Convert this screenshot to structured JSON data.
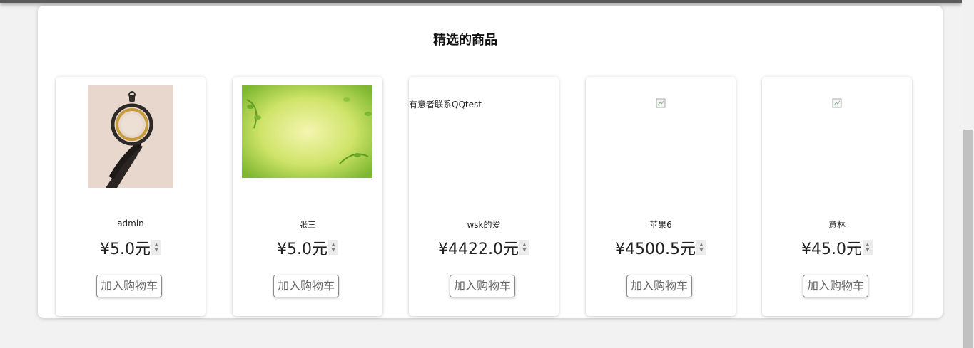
{
  "section": {
    "title": "精选的商品"
  },
  "products": [
    {
      "name": "admin",
      "price": "¥5.0元",
      "button": "加入购物车",
      "image": "pocket-watch-photo"
    },
    {
      "name": "张三",
      "price": "¥5.0元",
      "button": "加入购物车",
      "image": "green-leaves-photo"
    },
    {
      "name": "wsk的爱",
      "price": "¥4422.0元",
      "button": "加入购物车",
      "image_alt": "有意者联系QQtest"
    },
    {
      "name": "苹果6",
      "price": "¥4500.5元",
      "button": "加入购物车",
      "image": "broken-image-icon"
    },
    {
      "name": "意林",
      "price": "¥45.0元",
      "button": "加入购物车",
      "image": "broken-image-icon"
    }
  ]
}
